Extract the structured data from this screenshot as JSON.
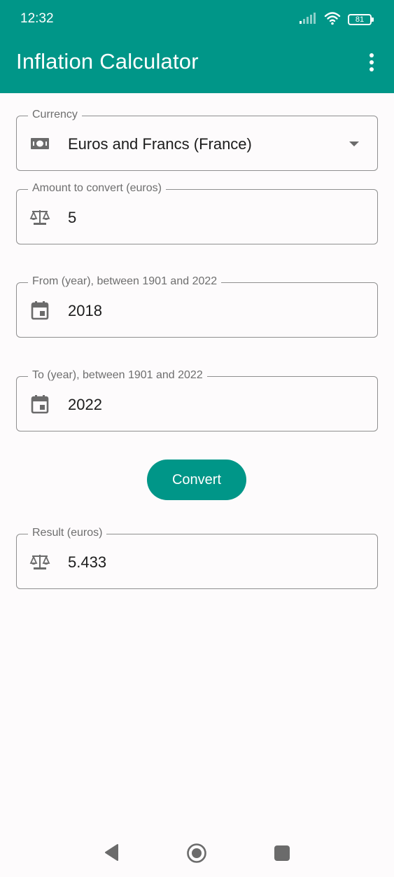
{
  "status_bar": {
    "time": "12:32",
    "battery": "81"
  },
  "app_bar": {
    "title": "Inflation Calculator",
    "menu_icon": "more-vert-icon",
    "color": "#009688"
  },
  "form": {
    "currency": {
      "label": "Currency",
      "value": "Euros and Francs (France)",
      "icon": "banknote-icon"
    },
    "amount": {
      "label": "Amount to convert (euros)",
      "value": "5",
      "icon": "scale-icon"
    },
    "from_year": {
      "label": "From (year), between 1901 and 2022",
      "value": "2018",
      "icon": "calendar-icon"
    },
    "to_year": {
      "label": "To (year), between 1901 and 2022",
      "value": "2022",
      "icon": "calendar-icon"
    },
    "convert_label": "Convert",
    "result": {
      "label": "Result (euros)",
      "value": "5.433",
      "icon": "scale-icon"
    }
  },
  "nav_bar": {
    "back_icon": "back-triangle-icon",
    "home_icon": "home-circle-icon",
    "recents_icon": "recents-square-icon"
  }
}
